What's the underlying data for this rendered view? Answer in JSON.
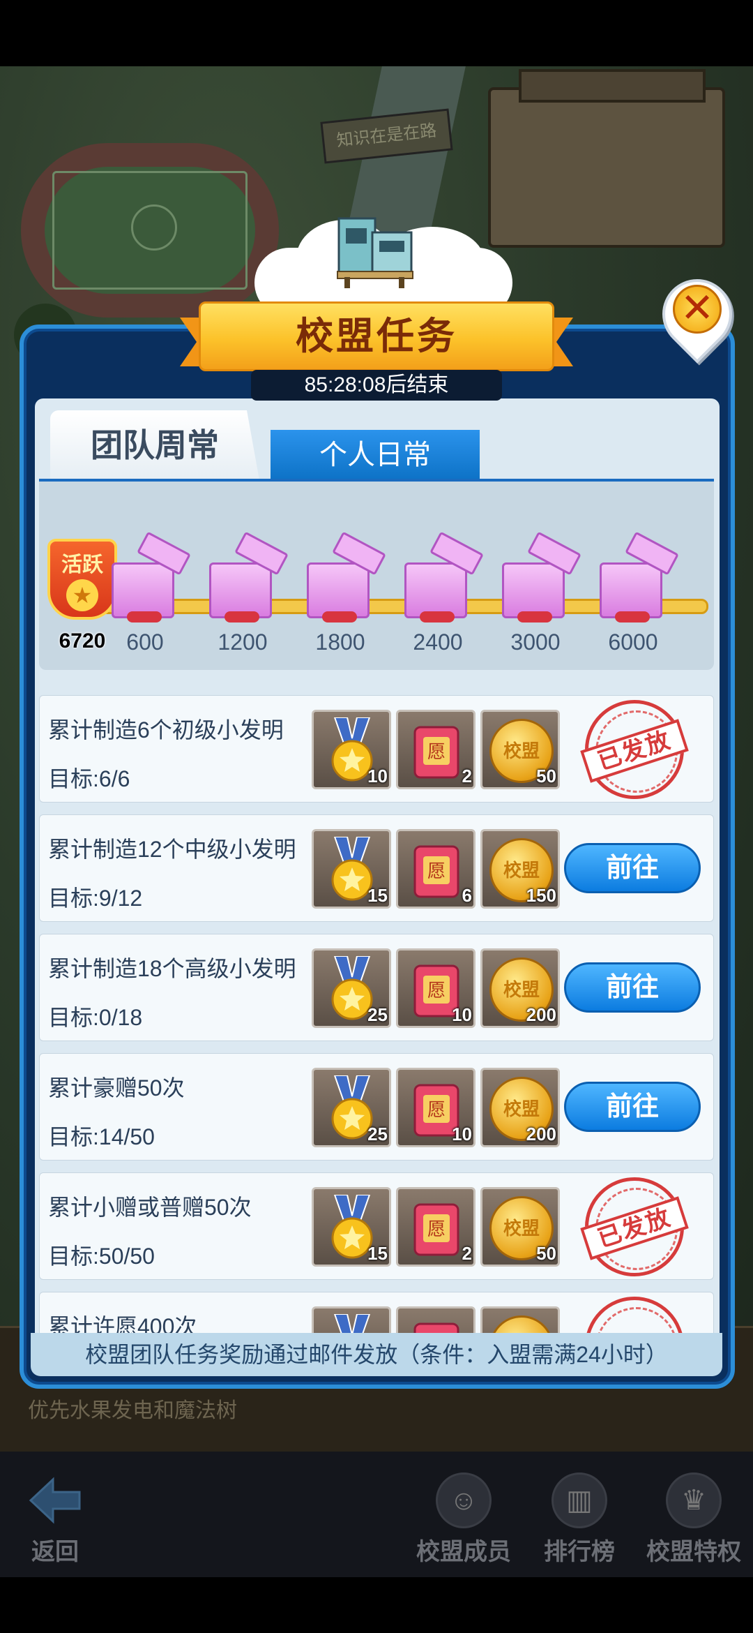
{
  "dialog": {
    "title": "校盟任务",
    "countdown": "85:28:08后结束",
    "close_icon": "close-icon"
  },
  "tabs": {
    "team": "团队周常",
    "personal": "个人日常",
    "active": "personal"
  },
  "progress": {
    "badge_label": "活跃",
    "current": "6720",
    "milestones": [
      "600",
      "1200",
      "1800",
      "2400",
      "3000",
      "6000"
    ]
  },
  "tasks": [
    {
      "title": "累计制造6个初级小发明",
      "target": "目标:6/6",
      "rewards": [
        "10",
        "2",
        "50"
      ],
      "status": "已发放"
    },
    {
      "title": "累计制造12个中级小发明",
      "target": "目标:9/12",
      "rewards": [
        "15",
        "6",
        "150"
      ],
      "status": "前往"
    },
    {
      "title": "累计制造18个高级小发明",
      "target": "目标:0/18",
      "rewards": [
        "25",
        "10",
        "200"
      ],
      "status": "前往"
    },
    {
      "title": "累计豪赠50次",
      "target": "目标:14/50",
      "rewards": [
        "25",
        "10",
        "200"
      ],
      "status": "前往"
    },
    {
      "title": "累计小赠或普赠50次",
      "target": "目标:50/50",
      "rewards": [
        "15",
        "2",
        "50"
      ],
      "status": "已发放"
    },
    {
      "title": "累计许愿400次",
      "target": "",
      "rewards": [
        "",
        "",
        ""
      ],
      "status": ""
    }
  ],
  "reward_icons": [
    "medal-icon",
    "wish-book-icon",
    "alliance-coin-icon"
  ],
  "coin_text": "校盟",
  "wish_text": "愿",
  "footer_note": "校盟团队任务奖励通过邮件发放（条件：入盟需满24小时）",
  "background": {
    "sign_text": "知识在是在路",
    "bottom_hint": "优先水果发电和魔法树"
  },
  "nav": {
    "back": "返回",
    "members": "校盟成员",
    "ranking": "排行榜",
    "privileges": "校盟特权"
  },
  "colors": {
    "dialog_frame": "#2c8ed8",
    "ribbon": "#fcc22a",
    "go_button": "#1a8cec",
    "stamp": "#d63b3b"
  }
}
